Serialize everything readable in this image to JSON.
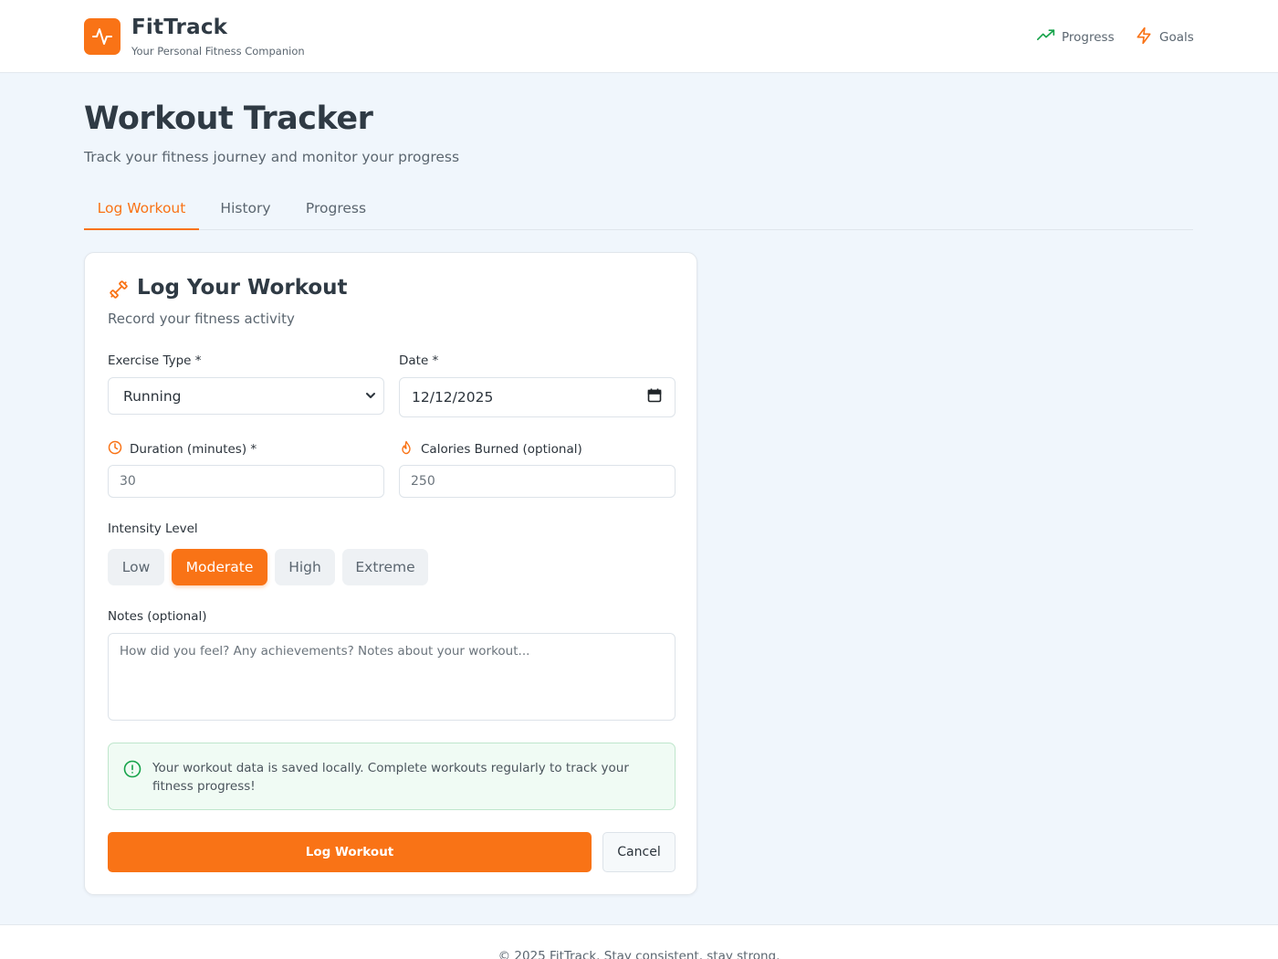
{
  "header": {
    "brand_title": "FitTrack",
    "brand_subtitle": "Your Personal Fitness Companion",
    "nav": [
      {
        "label": "Progress",
        "icon": "trending-up-icon",
        "color": "#16a34a"
      },
      {
        "label": "Goals",
        "icon": "zap-icon",
        "color": "#f97316"
      }
    ]
  },
  "page": {
    "title": "Workout Tracker",
    "subtitle": "Track your fitness journey and monitor your progress"
  },
  "tabs": [
    {
      "label": "Log Workout",
      "active": true
    },
    {
      "label": "History",
      "active": false
    },
    {
      "label": "Progress",
      "active": false
    }
  ],
  "form": {
    "title": "Log Your Workout",
    "subtitle": "Record your fitness activity",
    "exercise_label": "Exercise Type *",
    "exercise_value": "Running",
    "date_label": "Date *",
    "date_value": "12/12/2025",
    "duration_label": "Duration (minutes) *",
    "duration_placeholder": "30",
    "calories_label": "Calories Burned (optional)",
    "calories_placeholder": "250",
    "intensity_label": "Intensity Level",
    "intensity_options": [
      "Low",
      "Moderate",
      "High",
      "Extreme"
    ],
    "intensity_selected": "Moderate",
    "notes_label": "Notes (optional)",
    "notes_placeholder": "How did you feel? Any achievements? Notes about your workout...",
    "info_text": "Your workout data is saved locally. Complete workouts regularly to track your fitness progress!",
    "submit_label": "Log Workout",
    "cancel_label": "Cancel"
  },
  "footer": {
    "text": "© 2025 FitTrack. Stay consistent, stay strong."
  },
  "colors": {
    "accent": "#f97316",
    "success": "#16a34a",
    "background": "#f0f6fc"
  }
}
